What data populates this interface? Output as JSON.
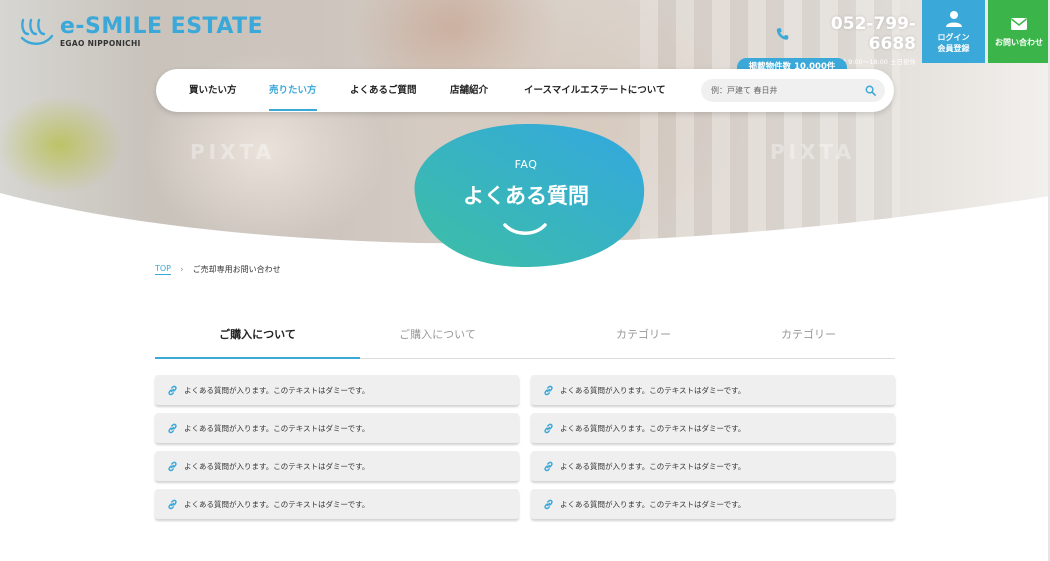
{
  "brand": {
    "name": "e-SMILE ESTATE",
    "sub": "EGAO NIPPONICHI",
    "accent": "#3aa8d8",
    "green": "#3bb54a"
  },
  "hero": {
    "watermark_left": "PIXTA",
    "watermark_right": "PIXTA"
  },
  "phone": {
    "number": "052-799-6688",
    "hours": "電話受付 9:00〜18:00 土日祝休"
  },
  "top_buttons": {
    "login_line1": "ログイン",
    "login_line2": "会員登録",
    "contact": "お問い合わせ"
  },
  "nav": {
    "items": [
      {
        "label": "買いたい方"
      },
      {
        "label": "売りたい方"
      },
      {
        "label": "よくあるご質問"
      },
      {
        "label": "店舗紹介"
      },
      {
        "label": "イースマイルエステートについて"
      }
    ],
    "active_index": 1,
    "search_placeholder": "例：戸建て 春日井",
    "count_badge": "掲載物件数 10,000件"
  },
  "faq_header": {
    "en": "FAQ",
    "jp": "よくある質問"
  },
  "breadcrumb": {
    "top": "TOP",
    "separator": "›",
    "current": "ご売却専用お問い合わせ"
  },
  "tabs": [
    {
      "label": "ご購入について"
    },
    {
      "label": "ご購入について"
    },
    {
      "label": "カテゴリー"
    },
    {
      "label": "カテゴリー"
    }
  ],
  "faq_items": {
    "left": [
      "よくある質問が入ります。このテキストはダミーです。",
      "よくある質問が入ります。このテキストはダミーです。",
      "よくある質問が入ります。このテキストはダミーです。",
      "よくある質問が入ります。このテキストはダミーです。"
    ],
    "right": [
      "よくある質問が入ります。このテキストはダミーです。",
      "よくある質問が入ります。このテキストはダミーです。",
      "よくある質問が入ります。このテキストはダミーです。",
      "よくある質問が入ります。このテキストはダミーです。"
    ]
  }
}
